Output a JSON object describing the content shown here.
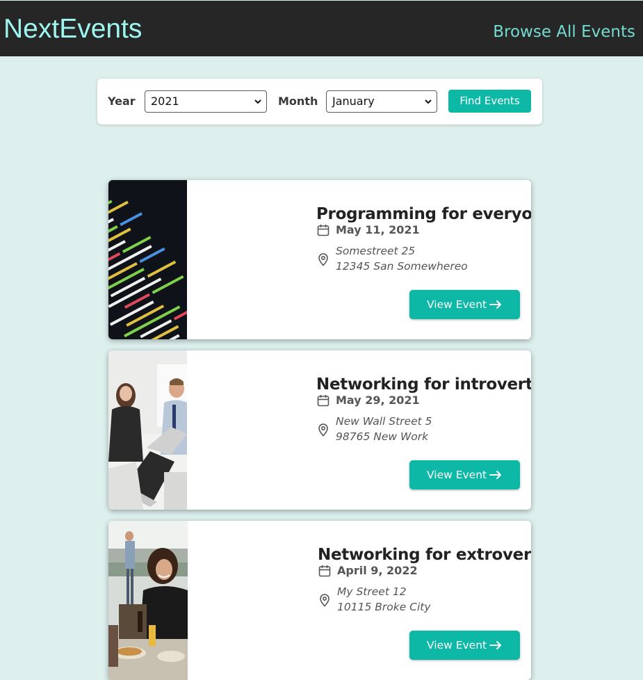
{
  "header": {
    "logo": "NextEvents",
    "nav_link": "Browse All Events"
  },
  "filter": {
    "year_label": "Year",
    "year_value": "2021",
    "month_label": "Month",
    "month_value": "January",
    "submit_label": "Find Events"
  },
  "events": [
    {
      "title": "Programming for everyone",
      "date": "May 11, 2021",
      "address_line1": "Somestreet 25",
      "address_line2": "12345 San Somewhereo",
      "button_label": "View Event",
      "image": "code-on-screen-photo"
    },
    {
      "title": "Networking for introverts",
      "date": "May 29, 2021",
      "address_line1": "New Wall Street 5",
      "address_line2": "98765 New Work",
      "button_label": "View Event",
      "image": "office-meeting-photo"
    },
    {
      "title": "Networking for extroverts",
      "date": "April 9, 2022",
      "address_line1": "My Street 12",
      "address_line2": "10115 Broke City",
      "button_label": "View Event",
      "image": "outdoor-party-photo"
    }
  ],
  "colors": {
    "background": "#ddf0ee",
    "header": "#262626",
    "logo": "#9ff5ef",
    "accent": "#0eb8a6"
  },
  "icons": {
    "date": "calendar-icon",
    "address": "map-pin-icon",
    "button": "arrow-right-icon"
  }
}
